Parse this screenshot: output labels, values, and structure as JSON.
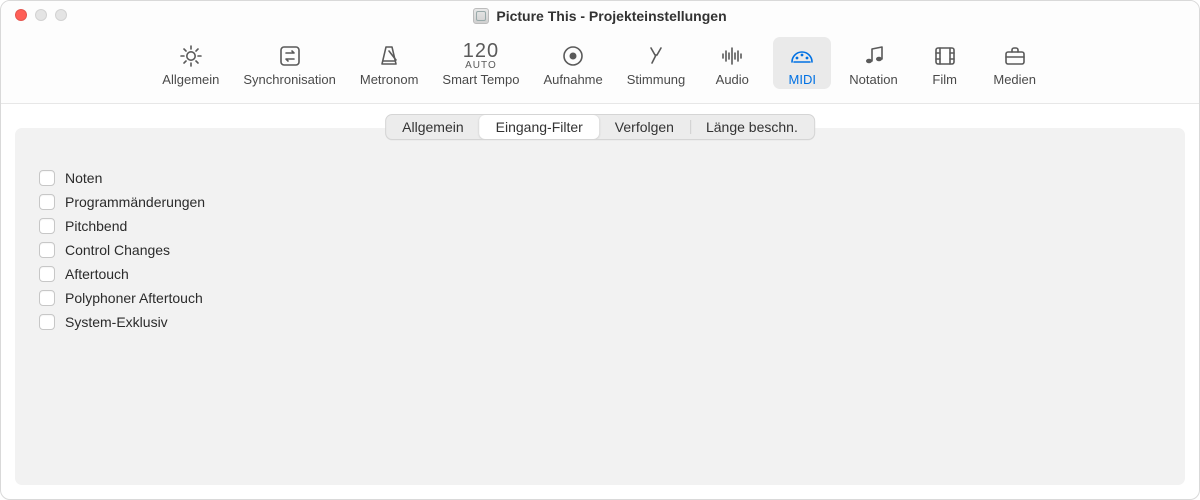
{
  "window": {
    "title": "Picture This - Projekteinstellungen"
  },
  "toolbar": {
    "items": [
      {
        "id": "allgemein",
        "label": "Allgemein"
      },
      {
        "id": "synchronisation",
        "label": "Synchronisation"
      },
      {
        "id": "metronom",
        "label": "Metronom"
      },
      {
        "id": "smarttempo",
        "label": "Smart Tempo",
        "tempo_value": "120",
        "tempo_sub": "AUTO"
      },
      {
        "id": "aufnahme",
        "label": "Aufnahme"
      },
      {
        "id": "stimmung",
        "label": "Stimmung"
      },
      {
        "id": "audio",
        "label": "Audio"
      },
      {
        "id": "midi",
        "label": "MIDI",
        "active": true
      },
      {
        "id": "notation",
        "label": "Notation"
      },
      {
        "id": "film",
        "label": "Film"
      },
      {
        "id": "medien",
        "label": "Medien"
      }
    ]
  },
  "subtabs": {
    "items": [
      {
        "id": "allgemein",
        "label": "Allgemein"
      },
      {
        "id": "eingangfilter",
        "label": "Eingang-Filter",
        "selected": true
      },
      {
        "id": "verfolgen",
        "label": "Verfolgen"
      },
      {
        "id": "laengebeschn",
        "label": "Länge beschn."
      }
    ]
  },
  "checkboxes": [
    {
      "id": "noten",
      "label": "Noten",
      "checked": false
    },
    {
      "id": "programm",
      "label": "Programmänderungen",
      "checked": false
    },
    {
      "id": "pitchbend",
      "label": "Pitchbend",
      "checked": false
    },
    {
      "id": "cc",
      "label": "Control Changes",
      "checked": false
    },
    {
      "id": "aftertouch",
      "label": "Aftertouch",
      "checked": false
    },
    {
      "id": "polyaftertouch",
      "label": "Polyphoner Aftertouch",
      "checked": false
    },
    {
      "id": "sysex",
      "label": "System-Exklusiv",
      "checked": false
    }
  ]
}
